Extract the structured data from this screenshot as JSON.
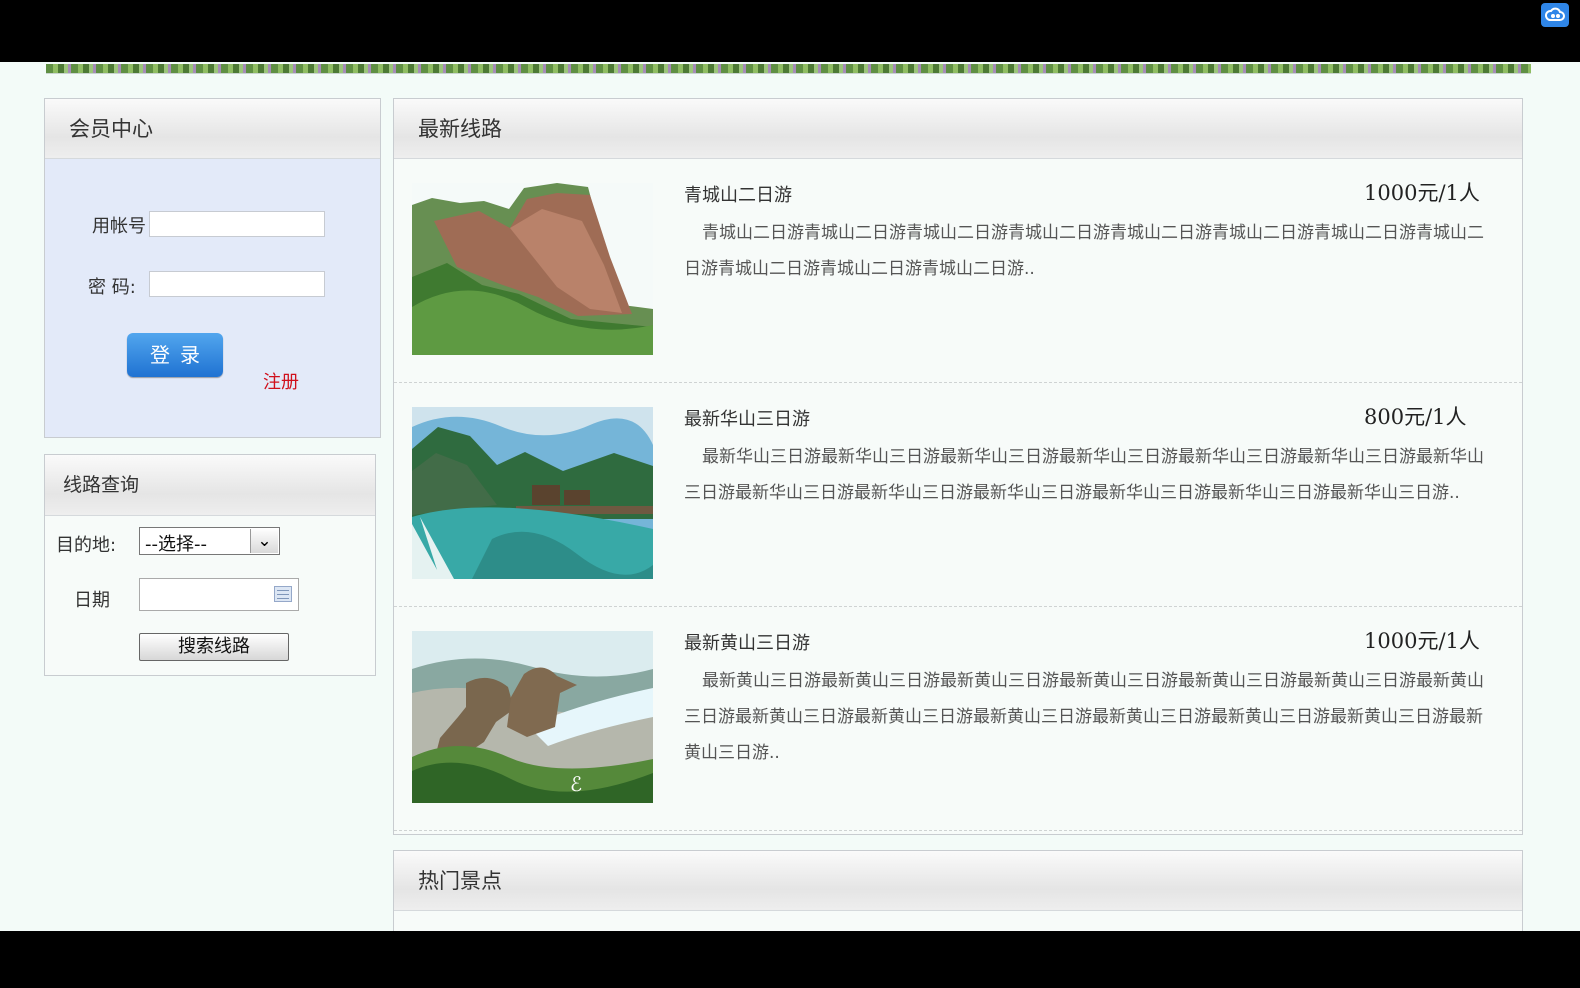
{
  "member": {
    "title": "会员中心",
    "account_label": "用帐号",
    "password_label": "密 码:",
    "login_button": "登录",
    "register_link": "注册"
  },
  "route_query": {
    "title": "线路查询",
    "destination_label": "目的地:",
    "destination_value": "--选择--",
    "date_label": "日期",
    "search_button": "搜索线路"
  },
  "latest_routes": {
    "title": "最新线路",
    "items": [
      {
        "name": "青城山二日游",
        "price": "1000元/1人",
        "description": "青城山二日游青城山二日游青城山二日游青城山二日游青城山二日游青城山二日游青城山二日游青城山二日游青城山二日游青城山二日游青城山二日游.."
      },
      {
        "name": "最新华山三日游",
        "price": "800元/1人",
        "description": "最新华山三日游最新华山三日游最新华山三日游最新华山三日游最新华山三日游最新华山三日游最新华山三日游最新华山三日游最新华山三日游最新华山三日游最新华山三日游最新华山三日游最新华山三日游.."
      },
      {
        "name": "最新黄山三日游",
        "price": "1000元/1人",
        "description": "最新黄山三日游最新黄山三日游最新黄山三日游最新黄山三日游最新黄山三日游最新黄山三日游最新黄山三日游最新黄山三日游最新黄山三日游最新黄山三日游最新黄山三日游最新黄山三日游最新黄山三日游最新黄山三日游.."
      }
    ]
  },
  "hot_spots": {
    "title": "热门景点"
  }
}
